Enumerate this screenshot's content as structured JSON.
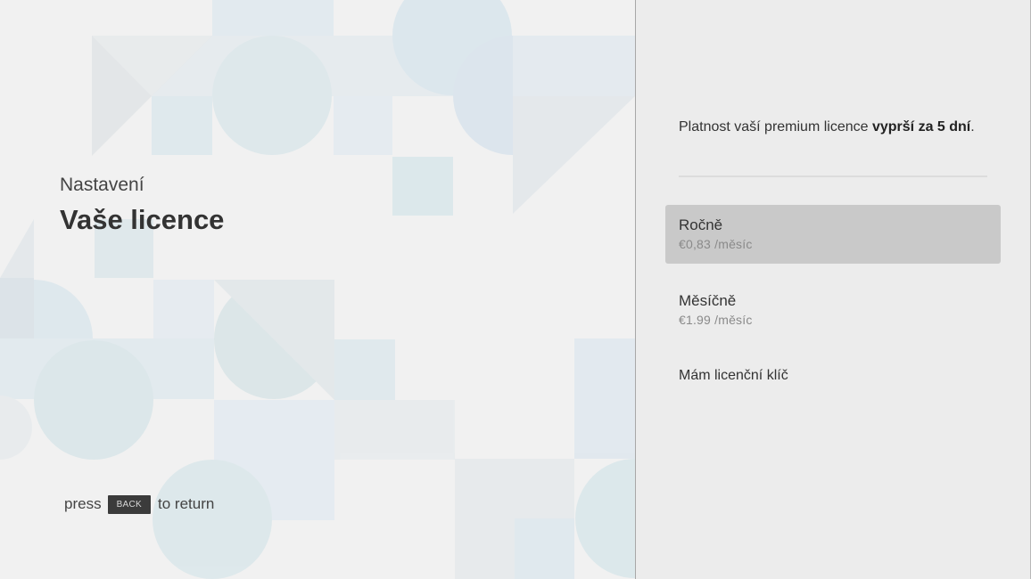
{
  "left": {
    "subtitle": "Nastavení",
    "title": "Vaše licence",
    "hint": {
      "prefix": "press",
      "key": "BACK",
      "suffix": "to return"
    }
  },
  "right": {
    "info": {
      "text_before": "Platnost vaší premium licence ",
      "text_bold": "vyprší za 5 dní",
      "text_after": "."
    },
    "options": [
      {
        "name": "Ročně",
        "price": "€0,83 /měsíc",
        "selected": true
      },
      {
        "name": "Měsíčně",
        "price": "€1.99 /měsíc",
        "selected": false
      },
      {
        "name": "Mám licenční klíč",
        "selected": false
      }
    ]
  },
  "colors": {
    "left_background": "#f1f1f1",
    "right_background": "#ececec",
    "selected_option": "#c9c9c9",
    "pattern_blue": "#dce8ef",
    "pattern_gray": "#e2e4e6"
  }
}
